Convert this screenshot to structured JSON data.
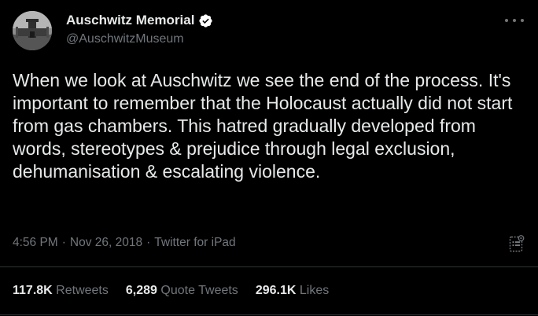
{
  "author": {
    "name": "Auschwitz Memorial",
    "handle": "@AuschwitzMuseum",
    "verified": true,
    "avatar_icon": "avatar-photo-icon"
  },
  "tweet": {
    "text": "When we look at Auschwitz we see the end of the process. It's important to remember that the Holocaust actually did not start from gas chambers. This hatred gradually developed from words, stereotypes & prejudice through legal exclusion, dehumanisation & escalating violence.",
    "time": "4:56 PM",
    "date": "Nov 26, 2018",
    "source": "Twitter for iPad",
    "separator": "·"
  },
  "stats": {
    "retweets_count": "117.8K",
    "retweets_label": "Retweets",
    "quote_count": "6,289",
    "quote_label": "Quote Tweets",
    "likes_count": "296.1K",
    "likes_label": "Likes"
  },
  "colors": {
    "background": "#000000",
    "primary_text": "#e7e9ea",
    "secondary_text": "#71767b",
    "verified_badge": "#ffffff",
    "divider": "#2f3336"
  },
  "icons": {
    "more": "more-options-icon",
    "analytics": "analytics-icon",
    "verified": "verified-badge-icon"
  }
}
